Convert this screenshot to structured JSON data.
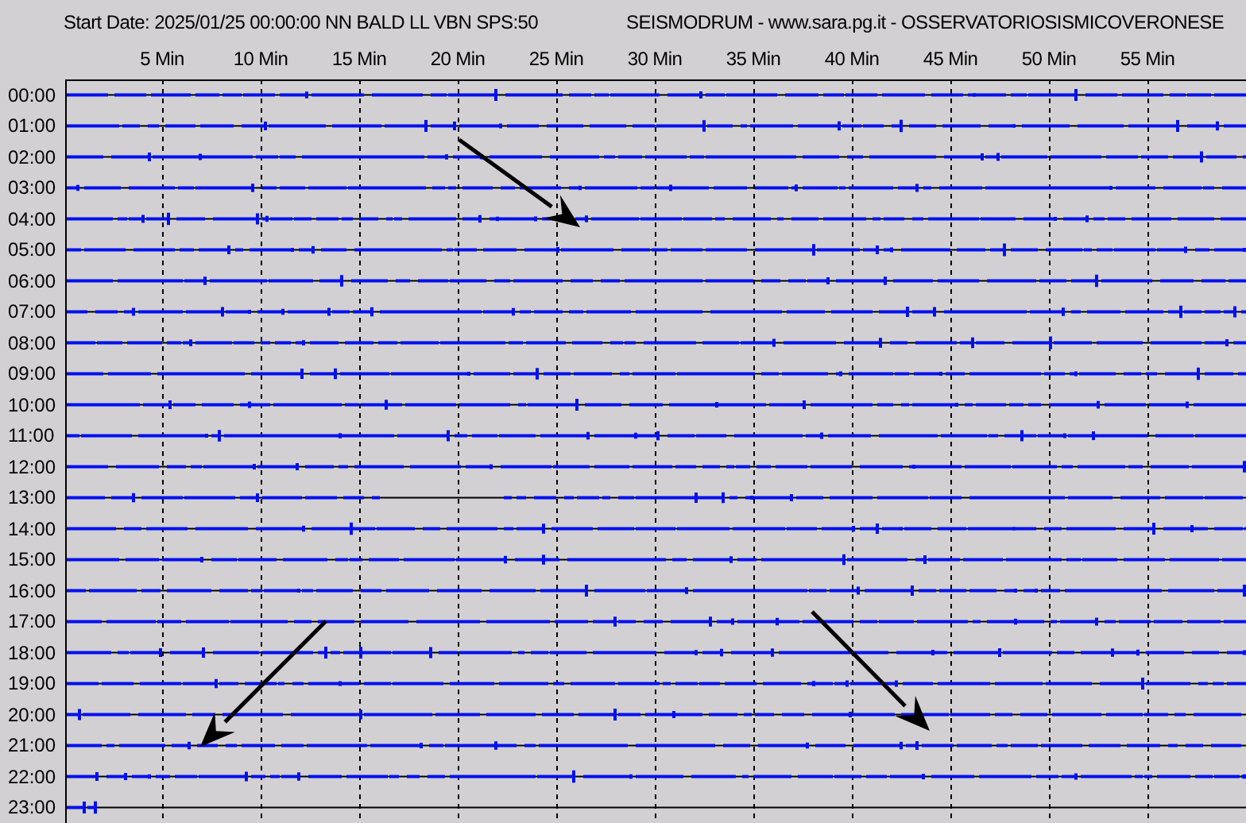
{
  "header": {
    "start_date": "Start Date: 2025/01/25 00:00:00 NN BALD LL VBN SPS:50",
    "title": "SEISMODRUM - www.sara.pg.it - OSSERVATORIOSISMICOVERONESE"
  },
  "minute_labels": [
    "5 Min",
    "10 Min",
    "15 Min",
    "20 Min",
    "25 Min",
    "30 Min",
    "35 Min",
    "40 Min",
    "45 Min",
    "50 Min",
    "55 Min"
  ],
  "hours": [
    "00:00",
    "01:00",
    "02:00",
    "03:00",
    "04:00",
    "05:00",
    "06:00",
    "07:00",
    "08:00",
    "09:00",
    "10:00",
    "11:00",
    "12:00",
    "13:00",
    "14:00",
    "15:00",
    "16:00",
    "17:00",
    "18:00",
    "19:00",
    "20:00",
    "21:00",
    "22:00",
    "23:00"
  ]
}
